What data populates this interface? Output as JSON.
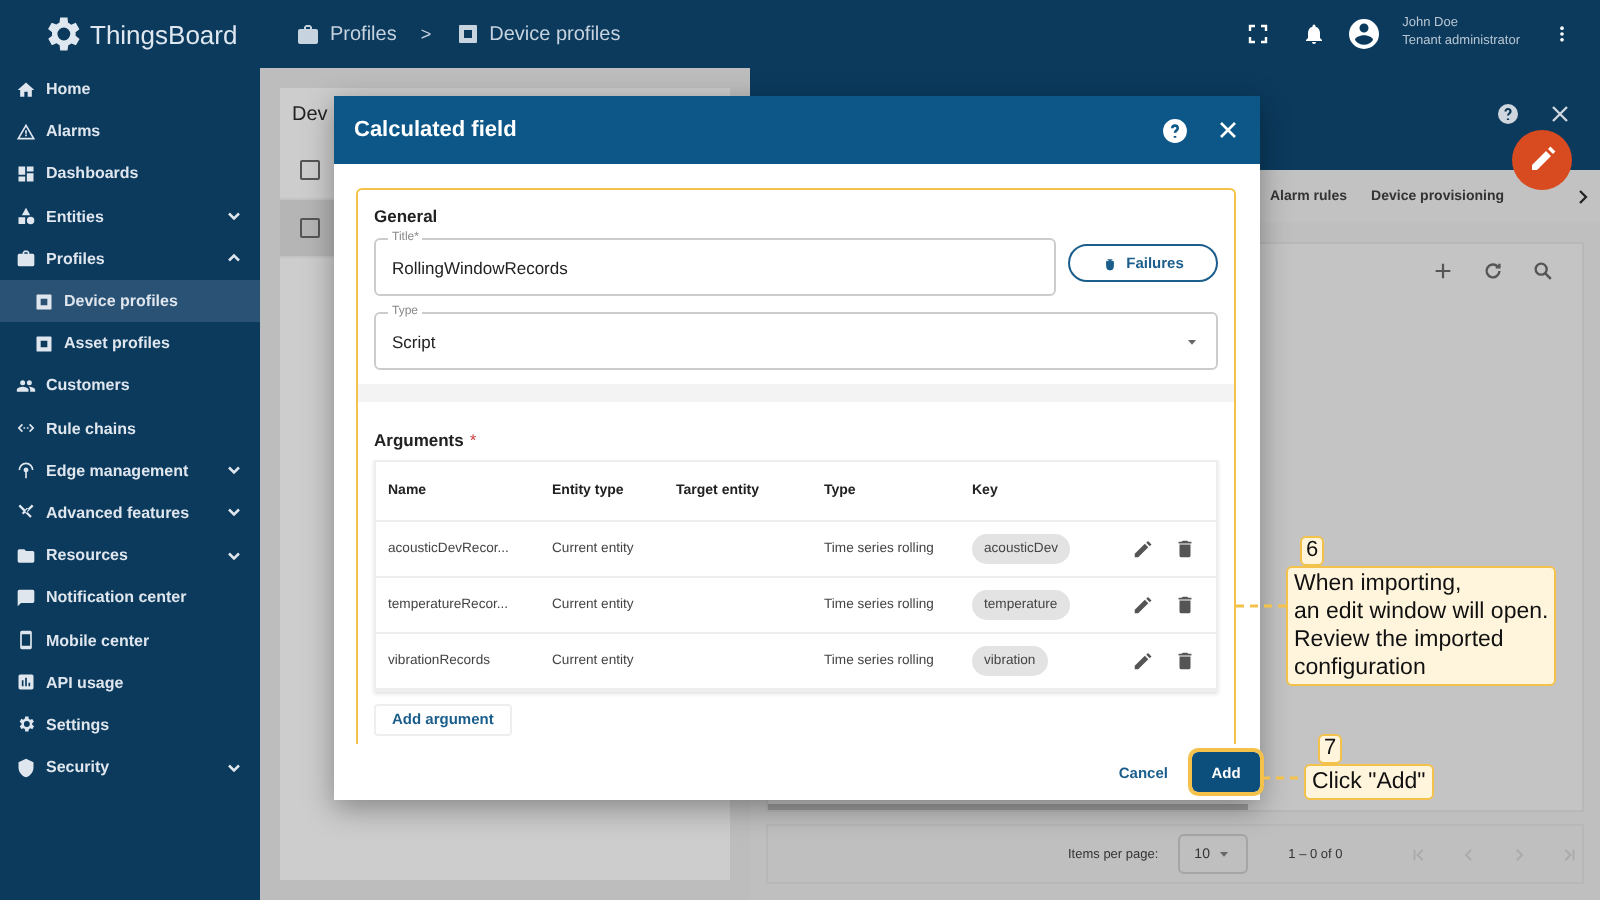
{
  "app": {
    "logo": "ThingsBoard"
  },
  "breadcrumb": {
    "items": [
      {
        "label": "Profiles"
      },
      {
        "label": "Device profiles"
      }
    ],
    "separator": ">"
  },
  "user": {
    "name": "John Doe",
    "role": "Tenant administrator"
  },
  "sidebar": {
    "items": [
      {
        "label": "Home",
        "selected": false
      },
      {
        "label": "Alarms",
        "selected": false
      },
      {
        "label": "Dashboards",
        "selected": false
      },
      {
        "label": "Entities",
        "selected": false,
        "expanded": false
      },
      {
        "label": "Profiles",
        "selected": false,
        "expanded": true,
        "children": [
          {
            "label": "Device profiles",
            "selected": true
          },
          {
            "label": "Asset profiles",
            "selected": false
          }
        ]
      },
      {
        "label": "Customers",
        "selected": false
      },
      {
        "label": "Rule chains",
        "selected": false
      },
      {
        "label": "Edge management",
        "selected": false,
        "expanded": false
      },
      {
        "label": "Advanced features",
        "selected": false,
        "expanded": false
      },
      {
        "label": "Resources",
        "selected": false,
        "expanded": false
      },
      {
        "label": "Notification center",
        "selected": false
      },
      {
        "label": "Mobile center",
        "selected": false
      },
      {
        "label": "API usage",
        "selected": false
      },
      {
        "label": "Settings",
        "selected": false
      },
      {
        "label": "Security",
        "selected": false,
        "expanded": false
      }
    ]
  },
  "profiles_list": {
    "title": "Dev",
    "rows": [
      {
        "selected": false,
        "checked": false
      },
      {
        "selected": true,
        "checked": false
      }
    ]
  },
  "details_panel": {
    "tabs": [
      {
        "label": "Alarm rules",
        "selected": false
      },
      {
        "label": "Device provisioning",
        "selected": false
      }
    ],
    "pagination": {
      "items_per_page_label": "Items per page:",
      "items_per_page": "10",
      "range": "1 – 0 of 0"
    }
  },
  "dialog": {
    "title": "Calculated field",
    "general": {
      "heading": "General",
      "title_field": {
        "label": "Title*",
        "value": "RollingWindowRecords"
      },
      "failures_button": "Failures",
      "type_field": {
        "label": "Type",
        "value": "Script"
      }
    },
    "arguments": {
      "heading": "Arguments",
      "required_mark": "*",
      "columns": [
        "Name",
        "Entity type",
        "Target entity",
        "Type",
        "Key"
      ],
      "rows": [
        {
          "name": "acousticDevRecor...",
          "entity_type": "Current entity",
          "type": "Time series rolling",
          "key": "acousticDev"
        },
        {
          "name": "temperatureRecor...",
          "entity_type": "Current entity",
          "type": "Time series rolling",
          "key": "temperature"
        },
        {
          "name": "vibrationRecords",
          "entity_type": "Current entity",
          "type": "Time series rolling",
          "key": "vibration"
        }
      ],
      "add_button": "Add argument"
    },
    "buttons": [
      {
        "label": "Cancel",
        "kind": "text"
      },
      {
        "label": "Add",
        "kind": "primary"
      }
    ]
  },
  "callouts": [
    {
      "number": "6",
      "text": "When importing,\nan edit window will open.\nReview the imported\nconfiguration"
    },
    {
      "number": "7",
      "text": "Click \"Add\""
    }
  ]
}
